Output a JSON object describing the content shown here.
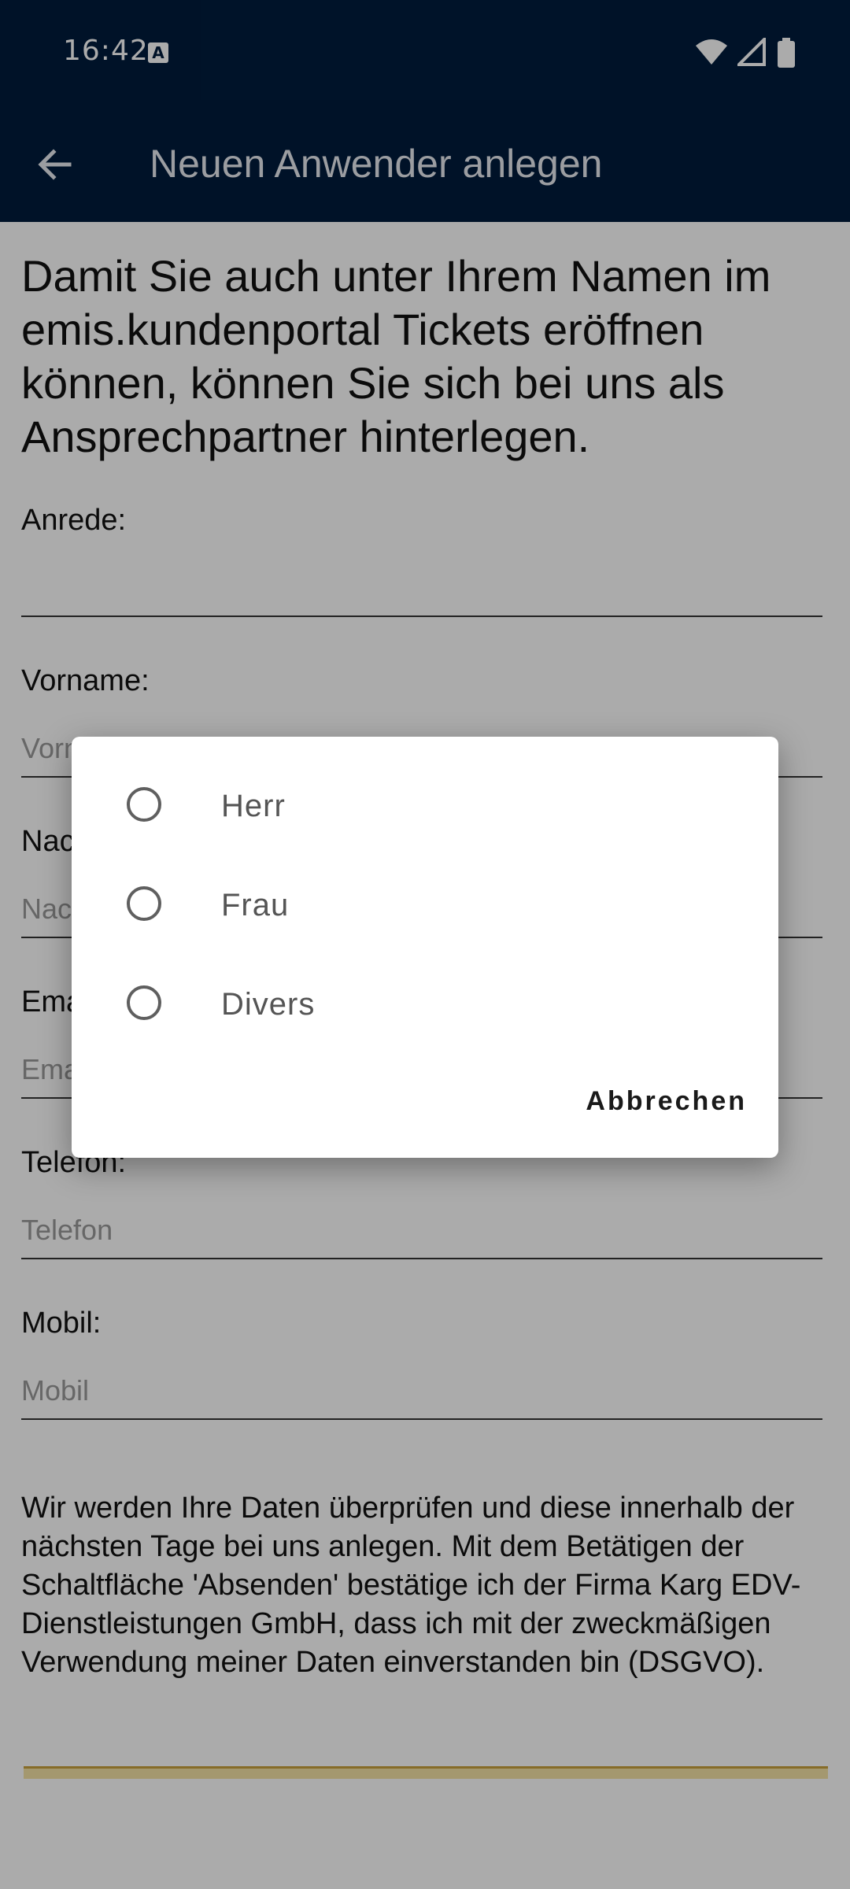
{
  "status_bar": {
    "time": "16:42",
    "icons": [
      "a-icon",
      "wifi-icon",
      "signal-icon",
      "battery-icon"
    ]
  },
  "app_bar": {
    "title": "Neuen Anwender anlegen",
    "back_icon": "arrow-left-icon"
  },
  "form": {
    "intro": "Damit Sie auch unter Ihrem Namen im emis.kundenportal Tickets eröffnen können, können Sie sich bei uns als Ansprechpartner hinterlegen.",
    "anrede": {
      "label": "Anrede:",
      "value": ""
    },
    "vorname": {
      "label": "Vorname:",
      "placeholder": "Vorname"
    },
    "nachname": {
      "label": "Nachname:",
      "placeholder": "Nachname"
    },
    "email": {
      "label": "Email:",
      "placeholder": "Email"
    },
    "telefon": {
      "label": "Telefon:",
      "placeholder": "Telefon"
    },
    "mobil": {
      "label": "Mobil:",
      "placeholder": "Mobil"
    },
    "privacy_text": "Wir werden Ihre Daten überprüfen und diese innerhalb der nächsten Tage bei uns anlegen. Mit dem Betätigen der Schaltfläche 'Absenden' bestätige ich der Firma Karg EDV-Dienstleistungen GmbH, dass ich mit der zweckmäßigen Verwendung meiner Daten einverstanden bin (DSGVO)."
  },
  "dialog": {
    "options": [
      {
        "label": "Herr"
      },
      {
        "label": "Frau"
      },
      {
        "label": "Divers"
      }
    ],
    "cancel_label": "Abbrechen"
  },
  "colors": {
    "app_bar": "#001c3d",
    "scrim": "rgba(0,0,0,0.33)",
    "accent_strip": "#c8a23c"
  }
}
